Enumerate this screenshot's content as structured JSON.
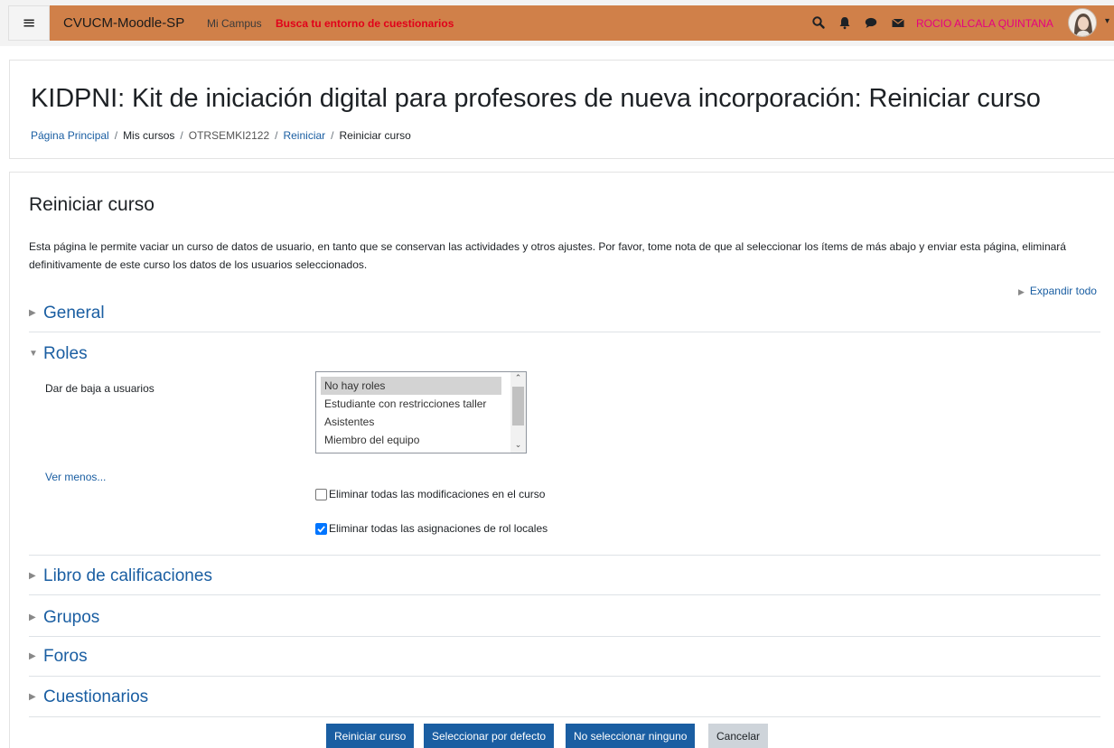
{
  "navbar": {
    "site_name": "CVUCM-Moodle-SP",
    "mi_campus": "Mi Campus",
    "busca_link": "Busca tu entorno de cuestionarios",
    "user_name": "ROCIO ALCALA QUINTANA",
    "icons": [
      "menu-icon",
      "search-icon",
      "bell-icon",
      "chat-icon",
      "envelope-icon"
    ],
    "accent_color": "#d08049"
  },
  "header": {
    "title": "KIDPNI: Kit de iniciación digital para profesores de nueva incorporación: Reiniciar curso",
    "breadcrumb": [
      "Página Principal",
      "Mis cursos",
      "OTRSEMKI2122",
      "Reiniciar",
      "Reiniciar curso"
    ]
  },
  "main": {
    "heading": "Reiniciar curso",
    "intro": "Esta página le permite vaciar un curso de datos de usuario, en tanto que se conservan las actividades y otros ajustes. Por favor, tome nota de que al seleccionar los ítems de más abajo y enviar esta página, eliminará definitivamente de este curso los datos de los usuarios seleccionados.",
    "expand_all": "Expandir todo",
    "sections": {
      "general": "General",
      "roles": "Roles",
      "gradebook": "Libro de calificaciones",
      "groups": "Grupos",
      "forums": "Foros",
      "quizzes": "Cuestionarios"
    },
    "roles": {
      "unenrol_label": "Dar de baja a usuarios",
      "options": [
        "No hay roles",
        "Estudiante con restricciones taller",
        "Asistentes",
        "Miembro del equipo"
      ],
      "selected": "No hay roles",
      "show_less": "Ver menos...",
      "check_overrides": "Eliminar todas las modificaciones en el curso",
      "check_overrides_checked": false,
      "check_local_roles": "Eliminar todas las asignaciones de rol locales",
      "check_local_roles_checked": true
    },
    "buttons": {
      "reset": "Reiniciar curso",
      "select_default": "Seleccionar por defecto",
      "deselect_all": "No seleccionar ninguno",
      "cancel": "Cancelar"
    }
  }
}
